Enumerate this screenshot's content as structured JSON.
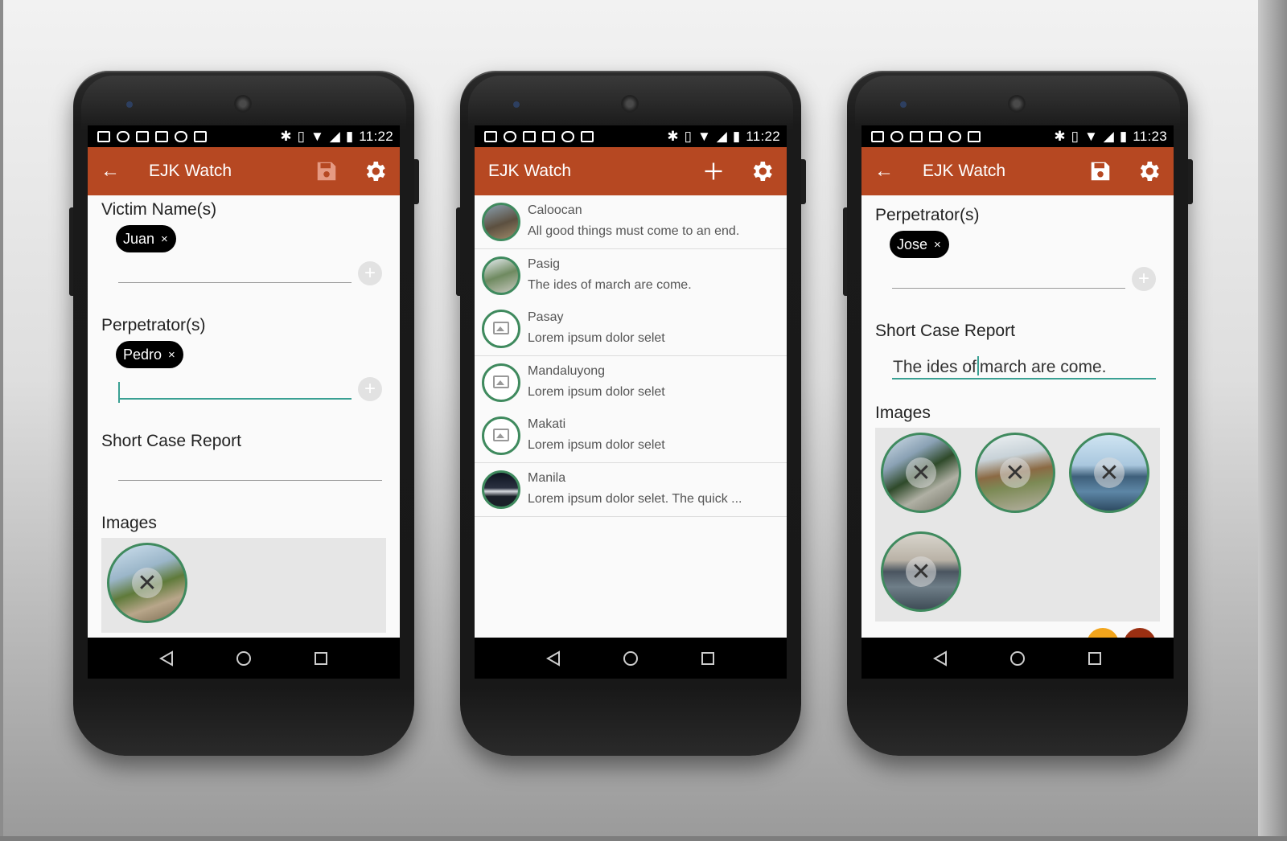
{
  "status": {
    "phone1_time": "11:22",
    "phone2_time": "11:22",
    "phone3_time": "11:23"
  },
  "app": {
    "title": "EJK Watch"
  },
  "colors": {
    "toolbar": "#b64822",
    "accent": "#3aa093",
    "thumb_border": "#3f8a5e"
  },
  "phone1": {
    "victim_label": "Victim Name(s)",
    "victim_chip": "Juan",
    "perp_label": "Perpetrator(s)",
    "perp_chip": "Pedro",
    "report_label": "Short Case Report",
    "images_label": "Images",
    "chip_remove": "×",
    "add_glyph": "+",
    "image_remove": "✕"
  },
  "phone2": {
    "items": [
      {
        "title": "Caloocan",
        "subtitle": "All good things must come to an end."
      },
      {
        "title": "Pasig",
        "subtitle": "The ides of march are come."
      },
      {
        "title": "Pasay",
        "subtitle": "Lorem ipsum dolor selet"
      },
      {
        "title": "Mandaluyong",
        "subtitle": "Lorem ipsum dolor selet"
      },
      {
        "title": "Makati",
        "subtitle": "Lorem ipsum dolor selet"
      },
      {
        "title": "Manila",
        "subtitle": "Lorem ipsum dolor selet. The quick ..."
      }
    ]
  },
  "phone3": {
    "perp_label": "Perpetrator(s)",
    "perp_chip": "Jose",
    "report_label": "Short Case Report",
    "report_value_a": "The ides of",
    "report_value_b": "march are come.",
    "images_label": "Images",
    "chip_remove": "×",
    "add_glyph": "+",
    "image_remove": "✕"
  },
  "icons": {
    "back": "arrow-back-icon",
    "save": "save-icon",
    "settings": "gear-icon",
    "add": "plus-icon",
    "nav": [
      "nav-back-icon",
      "nav-home-icon",
      "nav-recents-icon"
    ]
  }
}
